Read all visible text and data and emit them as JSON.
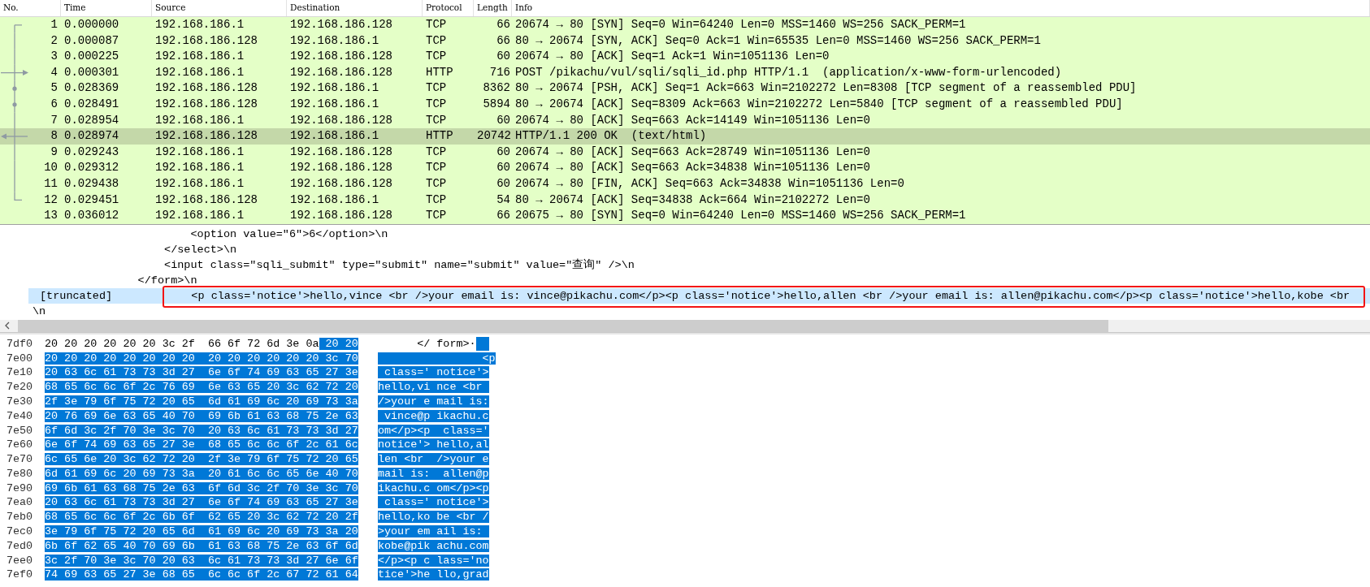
{
  "packet_list": {
    "columns": [
      "No.",
      "Time",
      "Source",
      "Destination",
      "Protocol",
      "Length",
      "Info"
    ],
    "rows": [
      {
        "no": "1",
        "time": "0.000000",
        "source": "192.168.186.1",
        "destination": "192.168.186.128",
        "protocol": "TCP",
        "length": "66",
        "info": "20674 → 80 [SYN] Seq=0 Win=64240 Len=0 MSS=1460 WS=256 SACK_PERM=1",
        "selected": false,
        "kind": "start"
      },
      {
        "no": "2",
        "time": "0.000087",
        "source": "192.168.186.128",
        "destination": "192.168.186.1",
        "protocol": "TCP",
        "length": "66",
        "info": "80 → 20674 [SYN, ACK] Seq=0 Ack=1 Win=65535 Len=0 MSS=1460 WS=256 SACK_PERM=1",
        "selected": false,
        "kind": "line"
      },
      {
        "no": "3",
        "time": "0.000225",
        "source": "192.168.186.1",
        "destination": "192.168.186.128",
        "protocol": "TCP",
        "length": "60",
        "info": "20674 → 80 [ACK] Seq=1 Ack=1 Win=1051136 Len=0",
        "selected": false,
        "kind": "line"
      },
      {
        "no": "4",
        "time": "0.000301",
        "source": "192.168.186.1",
        "destination": "192.168.186.128",
        "protocol": "HTTP",
        "length": "716",
        "info": "POST /pikachu/vul/sqli/sqli_id.php HTTP/1.1  (application/x-www-form-urlencoded)",
        "selected": false,
        "kind": "request"
      },
      {
        "no": "5",
        "time": "0.028369",
        "source": "192.168.186.128",
        "destination": "192.168.186.1",
        "protocol": "TCP",
        "length": "8362",
        "info": "80 → 20674 [PSH, ACK] Seq=1 Ack=663 Win=2102272 Len=8308 [TCP segment of a reassembled PDU]",
        "selected": false,
        "kind": "dot"
      },
      {
        "no": "6",
        "time": "0.028491",
        "source": "192.168.186.128",
        "destination": "192.168.186.1",
        "protocol": "TCP",
        "length": "5894",
        "info": "80 → 20674 [ACK] Seq=8309 Ack=663 Win=2102272 Len=5840 [TCP segment of a reassembled PDU]",
        "selected": false,
        "kind": "dot"
      },
      {
        "no": "7",
        "time": "0.028954",
        "source": "192.168.186.1",
        "destination": "192.168.186.128",
        "protocol": "TCP",
        "length": "60",
        "info": "20674 → 80 [ACK] Seq=663 Ack=14149 Win=1051136 Len=0",
        "selected": false,
        "kind": "line"
      },
      {
        "no": "8",
        "time": "0.028974",
        "source": "192.168.186.128",
        "destination": "192.168.186.1",
        "protocol": "HTTP",
        "length": "20742",
        "info": "HTTP/1.1 200 OK  (text/html)",
        "selected": true,
        "kind": "response"
      },
      {
        "no": "9",
        "time": "0.029243",
        "source": "192.168.186.1",
        "destination": "192.168.186.128",
        "protocol": "TCP",
        "length": "60",
        "info": "20674 → 80 [ACK] Seq=663 Ack=28749 Win=1051136 Len=0",
        "selected": false,
        "kind": "line"
      },
      {
        "no": "10",
        "time": "0.029312",
        "source": "192.168.186.1",
        "destination": "192.168.186.128",
        "protocol": "TCP",
        "length": "60",
        "info": "20674 → 80 [ACK] Seq=663 Ack=34838 Win=1051136 Len=0",
        "selected": false,
        "kind": "line"
      },
      {
        "no": "11",
        "time": "0.029438",
        "source": "192.168.186.1",
        "destination": "192.168.186.128",
        "protocol": "TCP",
        "length": "60",
        "info": "20674 → 80 [FIN, ACK] Seq=663 Ack=34838 Win=1051136 Len=0",
        "selected": false,
        "kind": "line"
      },
      {
        "no": "12",
        "time": "0.029451",
        "source": "192.168.186.128",
        "destination": "192.168.186.1",
        "protocol": "TCP",
        "length": "54",
        "info": "80 → 20674 [ACK] Seq=34838 Ack=664 Win=2102272 Len=0",
        "selected": false,
        "kind": "end"
      },
      {
        "no": "13",
        "time": "0.036012",
        "source": "192.168.186.1",
        "destination": "192.168.186.128",
        "protocol": "TCP",
        "length": "66",
        "info": "20675 → 80 [SYN] Seq=0 Win=64240 Len=0 MSS=1460 WS=256 SACK_PERM=1",
        "selected": false
      }
    ]
  },
  "details": {
    "lines": [
      {
        "kind": "text",
        "text": "                        <option value=\"6\">6</option>\\n"
      },
      {
        "kind": "text",
        "text": "                    </select>\\n"
      },
      {
        "kind": "text",
        "text": "                    <input class=\"sqli_submit\" type=\"submit\" name=\"submit\" value=\"查询\" />\\n"
      },
      {
        "kind": "text",
        "text": "                </form>\\n"
      },
      {
        "kind": "field",
        "label": "[truncated]",
        "value": "            <p class='notice'>hello,vince <br />your email is: vince@pikachu.com</p><p class='notice'>hello,allen <br />your email is: allen@pikachu.com</p><p class='notice'>hello,kobe <br",
        "selected": true,
        "annotated": true
      },
      {
        "kind": "text",
        "text": "\\n"
      }
    ]
  },
  "hex": {
    "rows": [
      {
        "offset": "7df0",
        "hex": [
          {
            "text": "20 20 20 20 20 20 3c 2f  66 6f 72 6d 3e 0a",
            "selected": false
          },
          {
            "text": "20 20",
            "selected": true
          }
        ],
        "ascii": [
          {
            "text": "      </ form>·",
            "selected": false
          }
        ],
        "ascii_tail_selected": true
      },
      {
        "offset": "7e00",
        "hex": [
          {
            "text": "20 20 20 20 20 20 20 20  20 20 20 20 20 20 3c 70",
            "selected": true
          }
        ],
        "ascii": [
          {
            "text": "                <p",
            "selected": true
          }
        ]
      },
      {
        "offset": "7e10",
        "hex": [
          {
            "text": "20 63 6c 61 73 73 3d 27  6e 6f 74 69 63 65 27 3e",
            "selected": true
          }
        ],
        "ascii": [
          {
            "text": " class=' notice'>",
            "selected": true
          }
        ]
      },
      {
        "offset": "7e20",
        "hex": [
          {
            "text": "68 65 6c 6c 6f 2c 76 69  6e 63 65 20 3c 62 72 20",
            "selected": true
          }
        ],
        "ascii": [
          {
            "text": "hello,vi nce <br ",
            "selected": true
          }
        ]
      },
      {
        "offset": "7e30",
        "hex": [
          {
            "text": "2f 3e 79 6f 75 72 20 65  6d 61 69 6c 20 69 73 3a",
            "selected": true
          }
        ],
        "ascii": [
          {
            "text": "/>your e mail is:",
            "selected": true
          }
        ]
      },
      {
        "offset": "7e40",
        "hex": [
          {
            "text": "20 76 69 6e 63 65 40 70  69 6b 61 63 68 75 2e 63",
            "selected": true
          }
        ],
        "ascii": [
          {
            "text": " vince@p ikachu.c",
            "selected": true
          }
        ]
      },
      {
        "offset": "7e50",
        "hex": [
          {
            "text": "6f 6d 3c 2f 70 3e 3c 70  20 63 6c 61 73 73 3d 27",
            "selected": true
          }
        ],
        "ascii": [
          {
            "text": "om</p><p  class='",
            "selected": true
          }
        ]
      },
      {
        "offset": "7e60",
        "hex": [
          {
            "text": "6e 6f 74 69 63 65 27 3e  68 65 6c 6c 6f 2c 61 6c",
            "selected": true
          }
        ],
        "ascii": [
          {
            "text": "notice'> hello,al",
            "selected": true
          }
        ]
      },
      {
        "offset": "7e70",
        "hex": [
          {
            "text": "6c 65 6e 20 3c 62 72 20  2f 3e 79 6f 75 72 20 65",
            "selected": true
          }
        ],
        "ascii": [
          {
            "text": "len <br  />your e",
            "selected": true
          }
        ]
      },
      {
        "offset": "7e80",
        "hex": [
          {
            "text": "6d 61 69 6c 20 69 73 3a  20 61 6c 6c 65 6e 40 70",
            "selected": true
          }
        ],
        "ascii": [
          {
            "text": "mail is:  allen@p",
            "selected": true
          }
        ]
      },
      {
        "offset": "7e90",
        "hex": [
          {
            "text": "69 6b 61 63 68 75 2e 63  6f 6d 3c 2f 70 3e 3c 70",
            "selected": true
          }
        ],
        "ascii": [
          {
            "text": "ikachu.c om</p><p",
            "selected": true
          }
        ]
      },
      {
        "offset": "7ea0",
        "hex": [
          {
            "text": "20 63 6c 61 73 73 3d 27  6e 6f 74 69 63 65 27 3e",
            "selected": true
          }
        ],
        "ascii": [
          {
            "text": " class=' notice'>",
            "selected": true
          }
        ]
      },
      {
        "offset": "7eb0",
        "hex": [
          {
            "text": "68 65 6c 6c 6f 2c 6b 6f  62 65 20 3c 62 72 20 2f",
            "selected": true
          }
        ],
        "ascii": [
          {
            "text": "hello,ko be <br /",
            "selected": true
          }
        ]
      },
      {
        "offset": "7ec0",
        "hex": [
          {
            "text": "3e 79 6f 75 72 20 65 6d  61 69 6c 20 69 73 3a 20",
            "selected": true
          }
        ],
        "ascii": [
          {
            "text": ">your em ail is: ",
            "selected": true
          }
        ]
      },
      {
        "offset": "7ed0",
        "hex": [
          {
            "text": "6b 6f 62 65 40 70 69 6b  61 63 68 75 2e 63 6f 6d",
            "selected": true
          }
        ],
        "ascii": [
          {
            "text": "kobe@pik achu.com",
            "selected": true
          }
        ]
      },
      {
        "offset": "7ee0",
        "hex": [
          {
            "text": "3c 2f 70 3e 3c 70 20 63  6c 61 73 73 3d 27 6e 6f",
            "selected": true
          }
        ],
        "ascii": [
          {
            "text": "</p><p c lass='no",
            "selected": true
          }
        ]
      },
      {
        "offset": "7ef0",
        "hex": [
          {
            "text": "74 69 63 65 27 3e 68 65  6c 6c 6f 2c 67 72 61 64",
            "selected": true
          }
        ],
        "ascii": [
          {
            "text": "tice'>he llo,grad",
            "selected": true
          }
        ]
      }
    ]
  }
}
